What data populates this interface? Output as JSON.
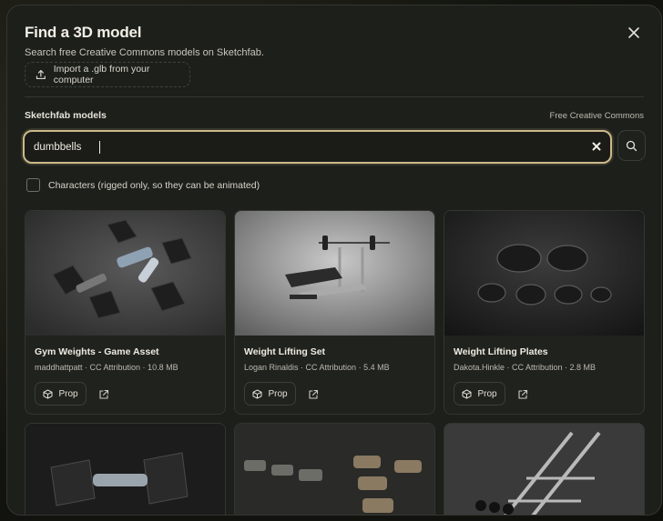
{
  "dialog": {
    "title": "Find a 3D model",
    "subtitle": "Search free Creative Commons models on Sketchfab.",
    "import_label": "Import a .glb from your computer",
    "close_icon": "close-icon"
  },
  "section": {
    "label": "Sketchfab models",
    "meta": "Free Creative Commons"
  },
  "search": {
    "value": "dumbbells",
    "clear_icon": "x-icon",
    "submit_icon": "search-icon"
  },
  "filter": {
    "characters_label": "Characters (rigged only, so they can be animated)",
    "characters_checked": false
  },
  "results": [
    {
      "name": "Gym Weights - Game Asset",
      "meta": "maddhattpatt · CC Attribution · 10.8 MB",
      "type_label": "Prop"
    },
    {
      "name": "Weight Lifting Set",
      "meta": "Logan Rinaldis · CC Attribution · 5.4 MB",
      "type_label": "Prop"
    },
    {
      "name": "Weight Lifting Plates",
      "meta": "Dakota.Hinkle · CC Attribution · 2.8 MB",
      "type_label": "Prop"
    }
  ],
  "colors": {
    "accent_border": "#cdb98b",
    "modal_bg": "#1d1f1b"
  }
}
